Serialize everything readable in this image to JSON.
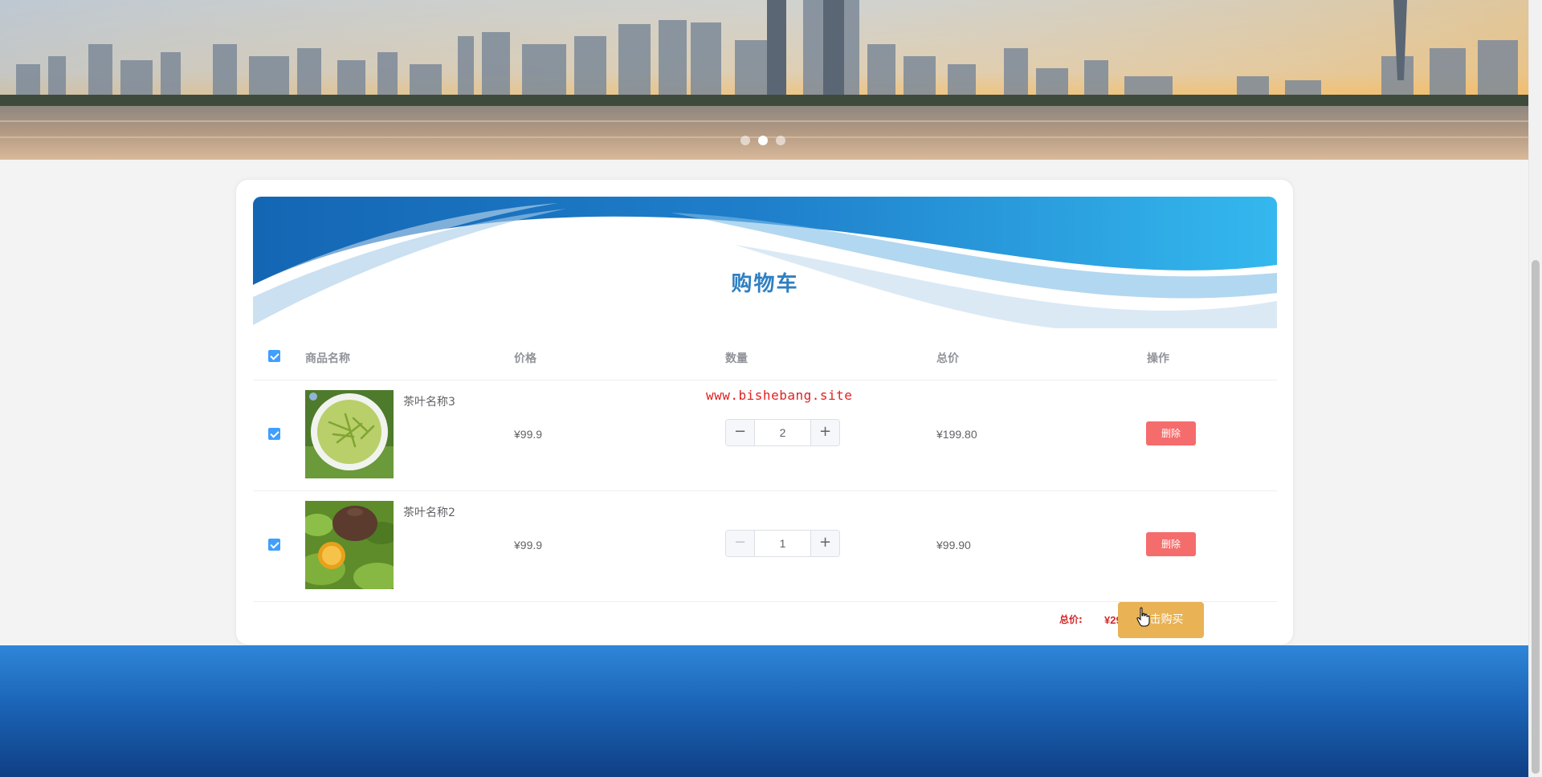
{
  "banner": {
    "image": "city-skyline-at-sunset",
    "slides": 3,
    "active_slide": 2
  },
  "cart": {
    "title": "购物车",
    "columns": {
      "name": "商品名称",
      "price": "价格",
      "quantity": "数量",
      "subtotal": "总价",
      "action": "操作"
    },
    "select_all": true,
    "items": [
      {
        "name": "茶叶名称3",
        "image": "green-tea-leaves-in-white-bowl",
        "price": "¥99.9",
        "quantity": "2",
        "subtotal": "¥199.80",
        "delete_label": "删除",
        "checked": true
      },
      {
        "name": "茶叶名称2",
        "image": "tea-leaves-with-clay-teapot-and-lemon",
        "price": "¥99.9",
        "quantity": "1",
        "subtotal": "¥99.90",
        "delete_label": "删除",
        "checked": true
      }
    ],
    "total_label": "总价:",
    "total_value": "¥299.70",
    "buy_label": "点击购买"
  },
  "watermark": "www.bishebang.site",
  "colors": {
    "accent": "#409eff",
    "danger": "#f56c6c",
    "buy": "#e8b255",
    "title": "#2f7fc1",
    "total": "#d62828",
    "footer": "#1b64b7"
  }
}
